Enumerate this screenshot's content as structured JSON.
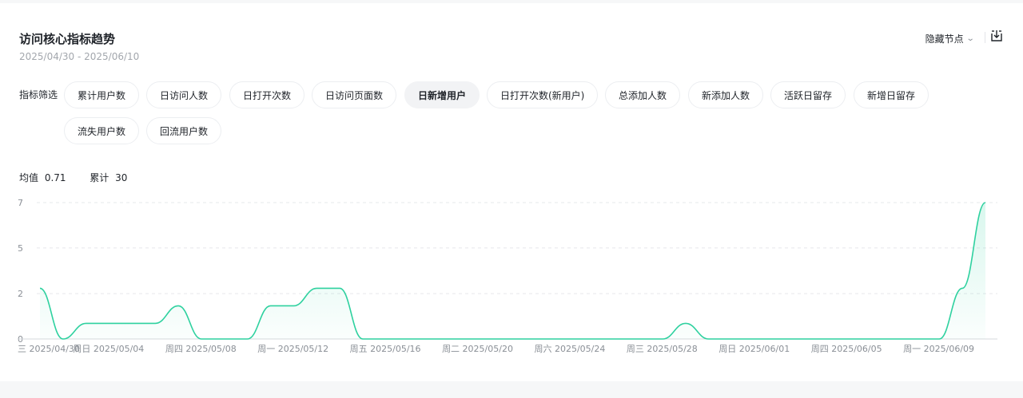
{
  "header": {
    "title": "访问核心指标趋势",
    "date_range": "2025/04/30 - 2025/06/10",
    "hide_nodes_label": "隐藏节点"
  },
  "filters": {
    "label": "指标筛选",
    "items": [
      {
        "label": "累计用户数",
        "active": false
      },
      {
        "label": "日访问人数",
        "active": false
      },
      {
        "label": "日打开次数",
        "active": false
      },
      {
        "label": "日访问页面数",
        "active": false
      },
      {
        "label": "日新增用户",
        "active": true
      },
      {
        "label": "日打开次数(新用户)",
        "active": false
      },
      {
        "label": "总添加人数",
        "active": false
      },
      {
        "label": "新添加人数",
        "active": false
      },
      {
        "label": "活跃日留存",
        "active": false
      },
      {
        "label": "新增日留存",
        "active": false
      },
      {
        "label": "流失用户数",
        "active": false
      },
      {
        "label": "回流用户数",
        "active": false
      }
    ]
  },
  "stats": {
    "avg_label": "均值",
    "avg_value": "0.71",
    "sum_label": "累计",
    "sum_value": "30"
  },
  "colors": {
    "line": "#2ed19f",
    "grid": "#e6e8eb"
  },
  "chart_data": {
    "type": "area",
    "title": "",
    "xlabel": "",
    "ylabel": "",
    "ylim": [
      0,
      7
    ],
    "yticks": [
      "0",
      "2",
      "5",
      "7"
    ],
    "x": [
      "2025/04/30",
      "2025/05/01",
      "2025/05/02",
      "2025/05/03",
      "2025/05/04",
      "2025/05/05",
      "2025/05/06",
      "2025/05/07",
      "2025/05/08",
      "2025/05/09",
      "2025/05/10",
      "2025/05/11",
      "2025/05/12",
      "2025/05/13",
      "2025/05/14",
      "2025/05/15",
      "2025/05/16",
      "2025/05/17",
      "2025/05/18",
      "2025/05/19",
      "2025/05/20",
      "2025/05/21",
      "2025/05/22",
      "2025/05/23",
      "2025/05/24",
      "2025/05/25",
      "2025/05/26",
      "2025/05/27",
      "2025/05/28",
      "2025/05/29",
      "2025/05/30",
      "2025/05/31",
      "2025/06/01",
      "2025/06/02",
      "2025/06/03",
      "2025/06/04",
      "2025/06/05",
      "2025/06/06",
      "2025/06/07",
      "2025/06/08",
      "2025/06/09",
      "2025/06/10"
    ],
    "values": [
      2.6,
      0,
      0.8,
      0.8,
      0.8,
      0.8,
      1.7,
      0,
      0,
      0,
      1.7,
      1.7,
      2.6,
      2.6,
      0,
      0,
      0,
      0,
      0,
      0,
      0,
      0,
      0,
      0,
      0,
      0,
      0,
      0,
      0.8,
      0,
      0,
      0,
      0,
      0,
      0,
      0,
      0,
      0,
      0,
      0,
      2.6,
      7
    ],
    "xtick_labels": [
      "三 2025/04/30",
      "周日 2025/05/04",
      "周四 2025/05/08",
      "周一 2025/05/12",
      "周五 2025/05/16",
      "周二 2025/05/20",
      "周六 2025/05/24",
      "周三 2025/05/28",
      "周日 2025/06/01",
      "周四 2025/06/05",
      "周一 2025/06/09"
    ],
    "xtick_indices": [
      0,
      4,
      8,
      12,
      16,
      20,
      24,
      28,
      32,
      36,
      40
    ]
  }
}
